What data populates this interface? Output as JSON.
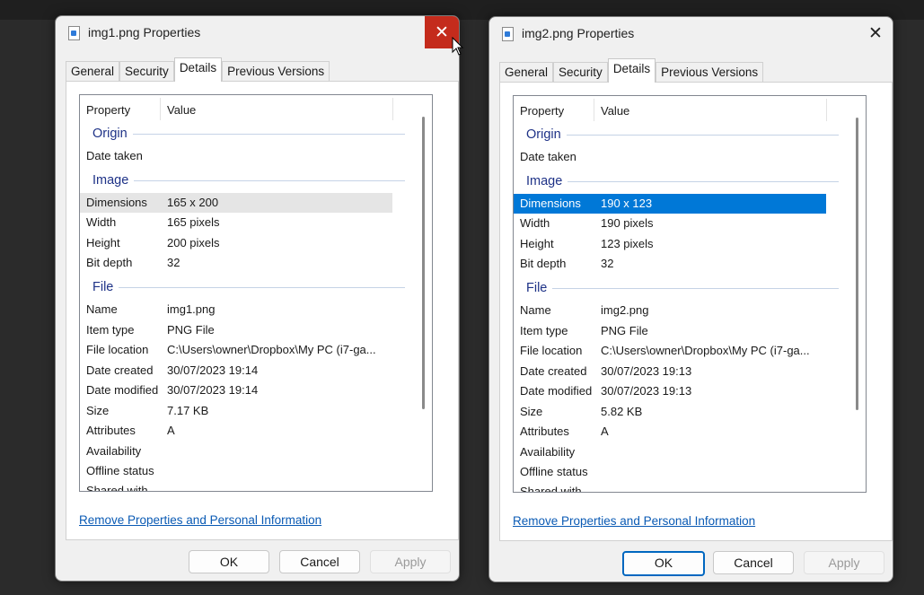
{
  "dialogs": [
    {
      "title": "img1.png Properties",
      "tabs": [
        "General",
        "Security",
        "Details",
        "Previous Versions"
      ],
      "columns": {
        "property": "Property",
        "value": "Value"
      },
      "groups": {
        "origin": "Origin",
        "image": "Image",
        "file": "File"
      },
      "rows": {
        "date_taken": {
          "k": "Date taken",
          "v": ""
        },
        "dimensions": {
          "k": "Dimensions",
          "v": "165 x 200"
        },
        "width": {
          "k": "Width",
          "v": "165 pixels"
        },
        "height": {
          "k": "Height",
          "v": "200 pixels"
        },
        "bit_depth": {
          "k": "Bit depth",
          "v": "32"
        },
        "name": {
          "k": "Name",
          "v": "img1.png"
        },
        "item_type": {
          "k": "Item type",
          "v": "PNG File"
        },
        "file_location": {
          "k": "File location",
          "v": "C:\\Users\\owner\\Dropbox\\My PC (i7-ga..."
        },
        "date_created": {
          "k": "Date created",
          "v": "30/07/2023 19:14"
        },
        "date_modified": {
          "k": "Date modified",
          "v": "30/07/2023 19:14"
        },
        "size": {
          "k": "Size",
          "v": "7.17 KB"
        },
        "attributes": {
          "k": "Attributes",
          "v": "A"
        },
        "availability": {
          "k": "Availability",
          "v": ""
        },
        "offline_status": {
          "k": "Offline status",
          "v": ""
        },
        "shared_with": {
          "k": "Shared with",
          "v": ""
        }
      },
      "link": "Remove Properties and Personal Information",
      "buttons": {
        "ok": "OK",
        "cancel": "Cancel",
        "apply": "Apply"
      }
    },
    {
      "title": "img2.png Properties",
      "tabs": [
        "General",
        "Security",
        "Details",
        "Previous Versions"
      ],
      "columns": {
        "property": "Property",
        "value": "Value"
      },
      "groups": {
        "origin": "Origin",
        "image": "Image",
        "file": "File"
      },
      "rows": {
        "date_taken": {
          "k": "Date taken",
          "v": ""
        },
        "dimensions": {
          "k": "Dimensions",
          "v": "190 x 123"
        },
        "width": {
          "k": "Width",
          "v": "190 pixels"
        },
        "height": {
          "k": "Height",
          "v": "123 pixels"
        },
        "bit_depth": {
          "k": "Bit depth",
          "v": "32"
        },
        "name": {
          "k": "Name",
          "v": "img2.png"
        },
        "item_type": {
          "k": "Item type",
          "v": "PNG File"
        },
        "file_location": {
          "k": "File location",
          "v": "C:\\Users\\owner\\Dropbox\\My PC (i7-ga..."
        },
        "date_created": {
          "k": "Date created",
          "v": "30/07/2023 19:13"
        },
        "date_modified": {
          "k": "Date modified",
          "v": "30/07/2023 19:13"
        },
        "size": {
          "k": "Size",
          "v": "5.82 KB"
        },
        "attributes": {
          "k": "Attributes",
          "v": "A"
        },
        "availability": {
          "k": "Availability",
          "v": ""
        },
        "offline_status": {
          "k": "Offline status",
          "v": ""
        },
        "shared_with": {
          "k": "Shared with",
          "v": ""
        }
      },
      "link": "Remove Properties and Personal Information",
      "buttons": {
        "ok": "OK",
        "cancel": "Cancel",
        "apply": "Apply"
      }
    }
  ]
}
